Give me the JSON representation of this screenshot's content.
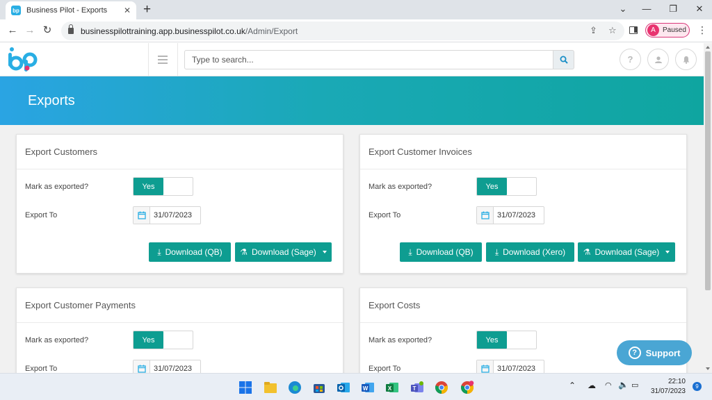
{
  "browser": {
    "tab_title": "Business Pilot - Exports",
    "tab_favicon": "bp",
    "url_host": "businesspilottraining.app.businesspilot.co.uk",
    "url_path": "/Admin/Export",
    "profile_initial": "A",
    "profile_status": "Paused"
  },
  "header": {
    "search_placeholder": "Type to search..."
  },
  "banner": {
    "title": "Exports"
  },
  "panels": [
    {
      "title": "Export Customers",
      "mark_label": "Mark as exported?",
      "toggle_value": "Yes",
      "export_to_label": "Export To",
      "date": "31/07/2023",
      "buttons": [
        "Download (QB)",
        "Download (Sage)"
      ]
    },
    {
      "title": "Export Customer Invoices",
      "mark_label": "Mark as exported?",
      "toggle_value": "Yes",
      "export_to_label": "Export To",
      "date": "31/07/2023",
      "buttons": [
        "Download (QB)",
        "Download (Xero)",
        "Download (Sage)"
      ]
    },
    {
      "title": "Export Customer Payments",
      "mark_label": "Mark as exported?",
      "toggle_value": "Yes",
      "export_to_label": "Export To",
      "date": "31/07/2023"
    },
    {
      "title": "Export Costs",
      "mark_label": "Mark as exported?",
      "toggle_value": "Yes",
      "export_to_label": "Export To",
      "date": "31/07/2023"
    }
  ],
  "support": {
    "label": "Support"
  },
  "taskbar": {
    "time": "22:10",
    "date": "31/07/2023",
    "notifications": "9"
  },
  "colors": {
    "accent": "#0e9d91",
    "banner_start": "#2aa4e3",
    "banner_end": "#0fa5a0",
    "support": "#4aa6d4"
  }
}
